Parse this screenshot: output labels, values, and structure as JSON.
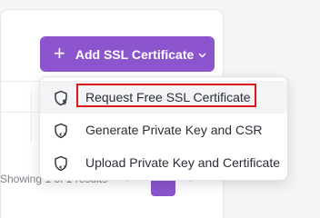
{
  "header": {
    "add_button_label": "Add SSL Certificate",
    "plus_symbol": "+"
  },
  "dropdown": {
    "items": [
      {
        "label": "Request Free SSL Certificate",
        "icon": "shield-dollar-icon",
        "highlighted": true
      },
      {
        "label": "Generate Private Key and CSR",
        "icon": "shield-code-icon",
        "highlighted": false
      },
      {
        "label": "Upload Private Key and Certificate",
        "icon": "shield-code-icon",
        "highlighted": false
      }
    ]
  },
  "pagination": {
    "summary_text": "Showing 1 of 1 results",
    "prev_symbol": "‹",
    "next_symbol": "›"
  },
  "colors": {
    "accent": "#8c55cd",
    "highlight": "#e0141b"
  }
}
